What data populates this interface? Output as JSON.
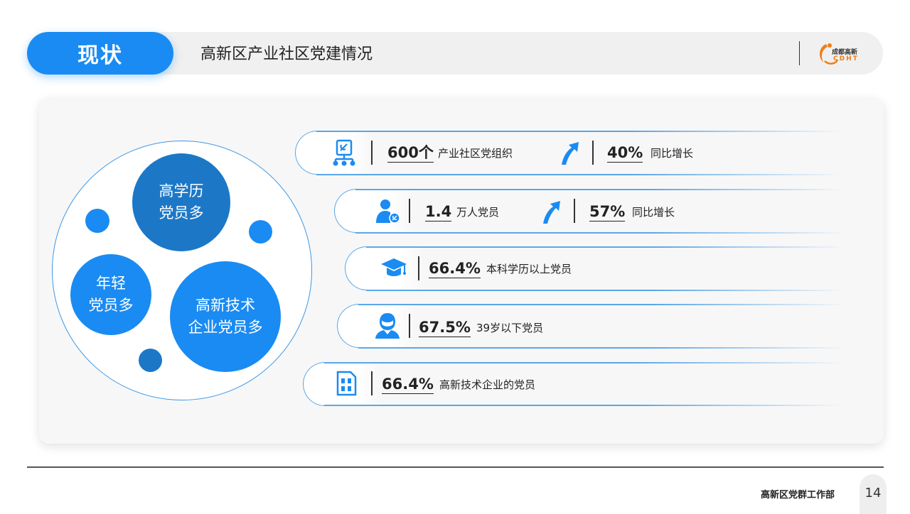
{
  "header": {
    "section": "现状",
    "title": "高新区产业社区党建情况",
    "logo": {
      "top": "成都高新",
      "bottom": "CDHT"
    }
  },
  "bubbles": {
    "education": [
      "高学历",
      "党员多"
    ],
    "young": [
      "年轻",
      "党员多"
    ],
    "tech": [
      "高新技术",
      "企业党员多"
    ]
  },
  "rows": [
    {
      "icon": "party-org-icon",
      "value": "600个",
      "label": "产业社区党组织",
      "growth": {
        "icon": "up-arrow-icon",
        "value": "40%",
        "label": "同比增长"
      }
    },
    {
      "icon": "party-member-icon",
      "value": "1.4",
      "label": "万人党员",
      "growth": {
        "icon": "up-arrow-icon",
        "value": "57%",
        "label": "同比增长"
      }
    },
    {
      "icon": "graduation-cap-icon",
      "value": "66.4%",
      "label": "本科学历以上党员"
    },
    {
      "icon": "person-icon",
      "value": "67.5%",
      "label": "39岁以下党员"
    },
    {
      "icon": "chip-icon",
      "value": "66.4%",
      "label": "高新技术企业的党员"
    }
  ],
  "colors": {
    "primary": "#1a8bf2",
    "dark": "#1c78c7",
    "logo": "#f07d1a"
  },
  "footer": {
    "department": "高新区党群工作部",
    "page": "14"
  }
}
